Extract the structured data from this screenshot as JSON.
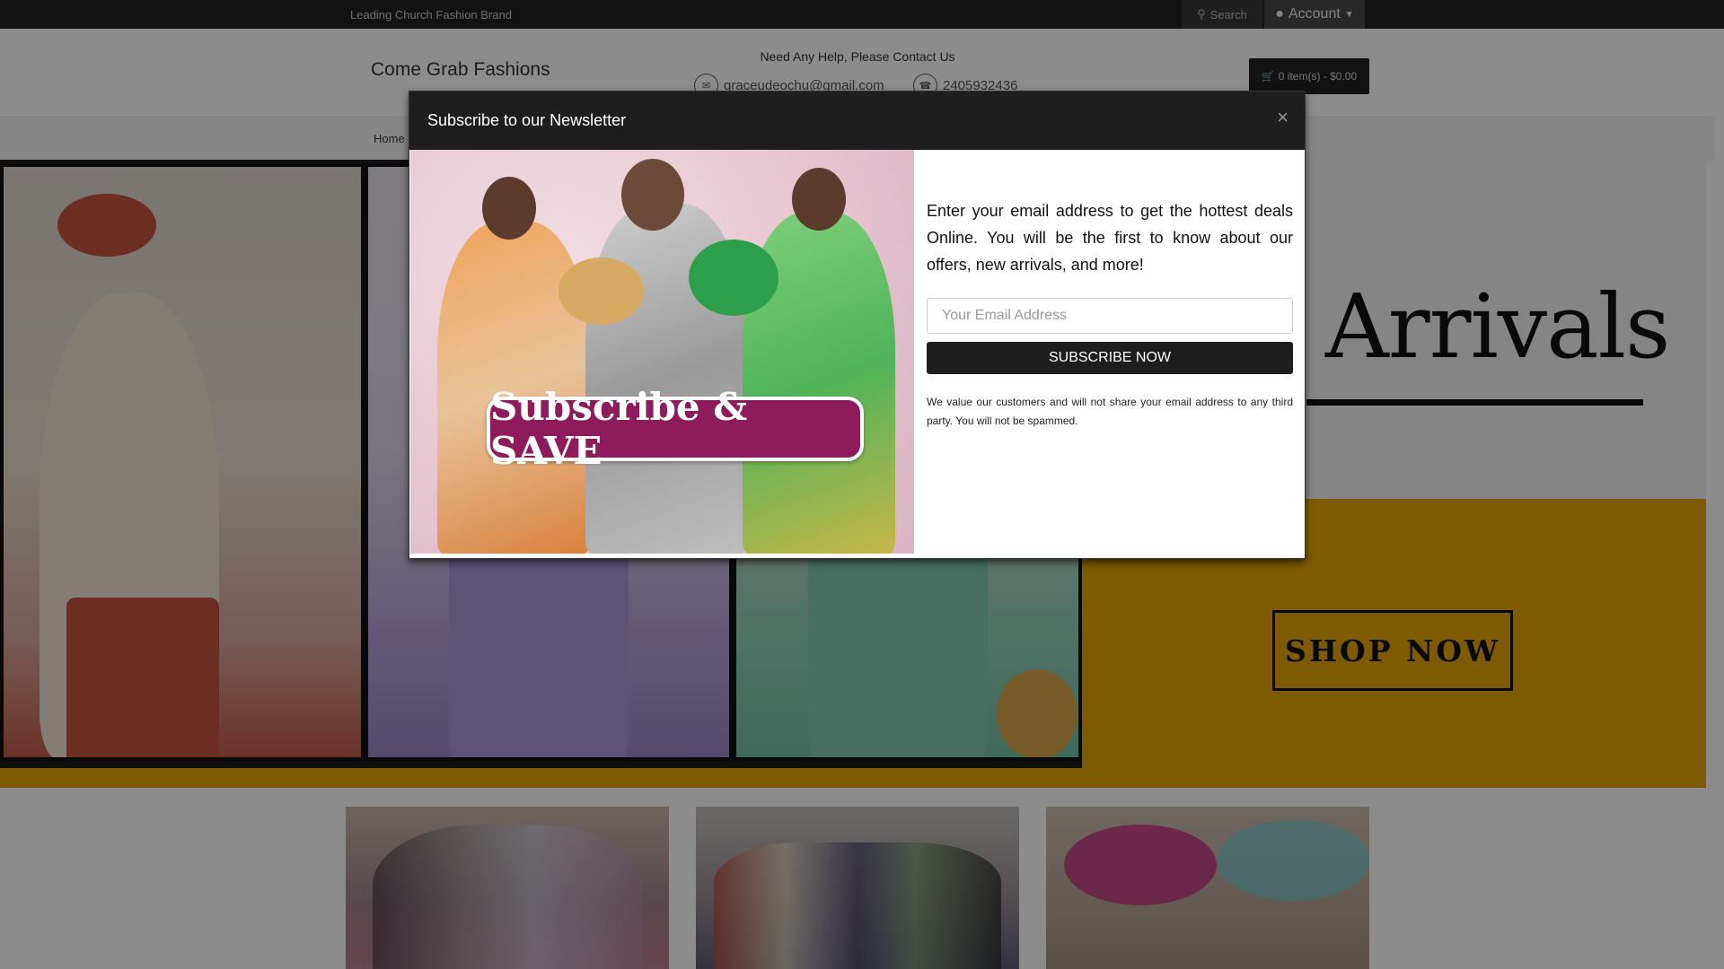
{
  "topbar": {
    "tagline": "Leading Church Fashion Brand",
    "search_label": "Search",
    "account_label": "Account"
  },
  "header": {
    "brand": "Come Grab Fashions",
    "help_text": "Need Any Help, Please Contact Us",
    "email": "graceudeochu@gmail.com",
    "phone": "2405932436",
    "cart_label": "0 item(s) - $0.00"
  },
  "nav": {
    "home": "Home"
  },
  "hero": {
    "headline": "Arrivals",
    "cta": "SHOP NOW"
  },
  "modal": {
    "title": "Subscribe to our Newsletter",
    "close": "×",
    "promo_text": "Subscribe & SAVE",
    "intro": "Enter your email address to get the hottest deals Online. You will be the first to know about our offers, new arrivals, and more!",
    "email_placeholder": "Your Email Address",
    "submit_label": "SUBSCRIBE NOW",
    "privacy_note": "We value our customers and will not share your email address to any third party. You will not be spammed."
  },
  "colors": {
    "dark": "#1e1e1e",
    "accent_yellow": "#e8a40a",
    "promo_magenta": "#8e1b5b"
  }
}
